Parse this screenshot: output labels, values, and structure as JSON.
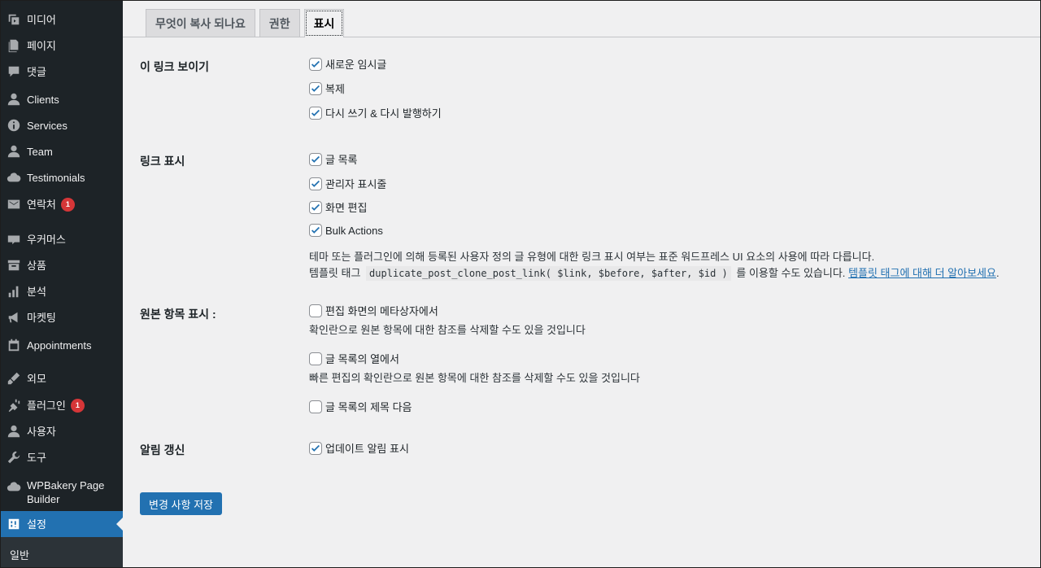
{
  "sidebar": {
    "items": [
      {
        "label": "미디어",
        "icon": "media-icon"
      },
      {
        "label": "페이지",
        "icon": "pages-icon"
      },
      {
        "label": "댓글",
        "icon": "comments-icon"
      },
      {
        "label": "Clients",
        "icon": "user-icon"
      },
      {
        "label": "Services",
        "icon": "info-icon"
      },
      {
        "label": "Team",
        "icon": "user-icon"
      },
      {
        "label": "Testimonials",
        "icon": "cloud-icon"
      },
      {
        "label": "연락처",
        "icon": "mail-icon",
        "badge": "1"
      },
      {
        "label": "우커머스",
        "icon": "woo-icon"
      },
      {
        "label": "상품",
        "icon": "archive-icon"
      },
      {
        "label": "분석",
        "icon": "chart-icon"
      },
      {
        "label": "마켓팅",
        "icon": "megaphone-icon"
      },
      {
        "label": "Appointments",
        "icon": "calendar-icon"
      },
      {
        "label": "외모",
        "icon": "brush-icon"
      },
      {
        "label": "플러그인",
        "icon": "plugin-icon",
        "badge": "1"
      },
      {
        "label": "사용자",
        "icon": "user-icon"
      },
      {
        "label": "도구",
        "icon": "wrench-icon"
      },
      {
        "label": "WPBakery Page Builder",
        "icon": "cloud-icon"
      },
      {
        "label": "설정",
        "icon": "settings-icon"
      }
    ],
    "submenu_label": "일반"
  },
  "tabs": [
    "무엇이 복사 되나요",
    "권한",
    "표시"
  ],
  "sections": {
    "show_links": {
      "label": "이 링크 보이기",
      "options": [
        {
          "label": "새로운 임시글",
          "checked": true
        },
        {
          "label": "복제",
          "checked": true
        },
        {
          "label": "다시 쓰기 & 다시 발행하기",
          "checked": true
        }
      ]
    },
    "link_display": {
      "label": "링크 표시",
      "options": [
        {
          "label": "글 목록",
          "checked": true
        },
        {
          "label": "관리자 표시줄",
          "checked": true
        },
        {
          "label": "화면 편집",
          "checked": true
        },
        {
          "label": "Bulk Actions",
          "checked": true
        }
      ],
      "desc_line1": "테마 또는 플러그인에 의해 등록된 사용자 정의 글 유형에 대한 링크 표시 여부는 표준 워드프레스 UI 요소의 사용에 따라 다릅니다.",
      "desc_line2_prefix": "템플릿 태그",
      "desc_code": "duplicate_post_clone_post_link( $link, $before, $after, $id )",
      "desc_line2_mid": "를 이용할 수도 있습니다.",
      "desc_link": "템플릿 태그에 대해 더 알아보세요",
      "desc_end": "."
    },
    "original_item": {
      "label": "원본 항목 표시 :",
      "options": [
        {
          "label": "편집 화면의 메타상자에서",
          "checked": false,
          "desc": "확인란으로 원본 항목에 대한 참조를 삭제할 수도 있을 것입니다"
        },
        {
          "label": "글 목록의 열에서",
          "checked": false,
          "desc": "빠른 편집의 확인란으로 원본 항목에 대한 참조를 삭제할 수도 있을 것입니다"
        },
        {
          "label": "글 목록의 제목 다음",
          "checked": false
        }
      ]
    },
    "notice": {
      "label": "알림 갱신",
      "options": [
        {
          "label": "업데이트 알림 표시",
          "checked": true
        }
      ]
    }
  },
  "save_button": "변경 사항 저장",
  "colors": {
    "sidebar_bg": "#1d2327",
    "accent": "#2271b1",
    "badge": "#d63638",
    "content_bg": "#f0f0f1"
  }
}
